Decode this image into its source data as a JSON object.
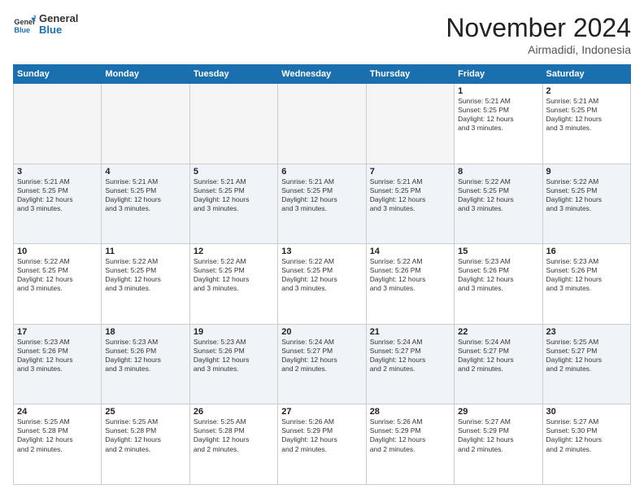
{
  "logo": {
    "line1": "General",
    "line2": "Blue"
  },
  "title": "November 2024",
  "location": "Airmadidi, Indonesia",
  "weekdays": [
    "Sunday",
    "Monday",
    "Tuesday",
    "Wednesday",
    "Thursday",
    "Friday",
    "Saturday"
  ],
  "weeks": [
    [
      {
        "day": "",
        "info": ""
      },
      {
        "day": "",
        "info": ""
      },
      {
        "day": "",
        "info": ""
      },
      {
        "day": "",
        "info": ""
      },
      {
        "day": "",
        "info": ""
      },
      {
        "day": "1",
        "info": "Sunrise: 5:21 AM\nSunset: 5:25 PM\nDaylight: 12 hours\nand 3 minutes."
      },
      {
        "day": "2",
        "info": "Sunrise: 5:21 AM\nSunset: 5:25 PM\nDaylight: 12 hours\nand 3 minutes."
      }
    ],
    [
      {
        "day": "3",
        "info": "Sunrise: 5:21 AM\nSunset: 5:25 PM\nDaylight: 12 hours\nand 3 minutes."
      },
      {
        "day": "4",
        "info": "Sunrise: 5:21 AM\nSunset: 5:25 PM\nDaylight: 12 hours\nand 3 minutes."
      },
      {
        "day": "5",
        "info": "Sunrise: 5:21 AM\nSunset: 5:25 PM\nDaylight: 12 hours\nand 3 minutes."
      },
      {
        "day": "6",
        "info": "Sunrise: 5:21 AM\nSunset: 5:25 PM\nDaylight: 12 hours\nand 3 minutes."
      },
      {
        "day": "7",
        "info": "Sunrise: 5:21 AM\nSunset: 5:25 PM\nDaylight: 12 hours\nand 3 minutes."
      },
      {
        "day": "8",
        "info": "Sunrise: 5:22 AM\nSunset: 5:25 PM\nDaylight: 12 hours\nand 3 minutes."
      },
      {
        "day": "9",
        "info": "Sunrise: 5:22 AM\nSunset: 5:25 PM\nDaylight: 12 hours\nand 3 minutes."
      }
    ],
    [
      {
        "day": "10",
        "info": "Sunrise: 5:22 AM\nSunset: 5:25 PM\nDaylight: 12 hours\nand 3 minutes."
      },
      {
        "day": "11",
        "info": "Sunrise: 5:22 AM\nSunset: 5:25 PM\nDaylight: 12 hours\nand 3 minutes."
      },
      {
        "day": "12",
        "info": "Sunrise: 5:22 AM\nSunset: 5:25 PM\nDaylight: 12 hours\nand 3 minutes."
      },
      {
        "day": "13",
        "info": "Sunrise: 5:22 AM\nSunset: 5:25 PM\nDaylight: 12 hours\nand 3 minutes."
      },
      {
        "day": "14",
        "info": "Sunrise: 5:22 AM\nSunset: 5:26 PM\nDaylight: 12 hours\nand 3 minutes."
      },
      {
        "day": "15",
        "info": "Sunrise: 5:23 AM\nSunset: 5:26 PM\nDaylight: 12 hours\nand 3 minutes."
      },
      {
        "day": "16",
        "info": "Sunrise: 5:23 AM\nSunset: 5:26 PM\nDaylight: 12 hours\nand 3 minutes."
      }
    ],
    [
      {
        "day": "17",
        "info": "Sunrise: 5:23 AM\nSunset: 5:26 PM\nDaylight: 12 hours\nand 3 minutes."
      },
      {
        "day": "18",
        "info": "Sunrise: 5:23 AM\nSunset: 5:26 PM\nDaylight: 12 hours\nand 3 minutes."
      },
      {
        "day": "19",
        "info": "Sunrise: 5:23 AM\nSunset: 5:26 PM\nDaylight: 12 hours\nand 3 minutes."
      },
      {
        "day": "20",
        "info": "Sunrise: 5:24 AM\nSunset: 5:27 PM\nDaylight: 12 hours\nand 2 minutes."
      },
      {
        "day": "21",
        "info": "Sunrise: 5:24 AM\nSunset: 5:27 PM\nDaylight: 12 hours\nand 2 minutes."
      },
      {
        "day": "22",
        "info": "Sunrise: 5:24 AM\nSunset: 5:27 PM\nDaylight: 12 hours\nand 2 minutes."
      },
      {
        "day": "23",
        "info": "Sunrise: 5:25 AM\nSunset: 5:27 PM\nDaylight: 12 hours\nand 2 minutes."
      }
    ],
    [
      {
        "day": "24",
        "info": "Sunrise: 5:25 AM\nSunset: 5:28 PM\nDaylight: 12 hours\nand 2 minutes."
      },
      {
        "day": "25",
        "info": "Sunrise: 5:25 AM\nSunset: 5:28 PM\nDaylight: 12 hours\nand 2 minutes."
      },
      {
        "day": "26",
        "info": "Sunrise: 5:25 AM\nSunset: 5:28 PM\nDaylight: 12 hours\nand 2 minutes."
      },
      {
        "day": "27",
        "info": "Sunrise: 5:26 AM\nSunset: 5:29 PM\nDaylight: 12 hours\nand 2 minutes."
      },
      {
        "day": "28",
        "info": "Sunrise: 5:26 AM\nSunset: 5:29 PM\nDaylight: 12 hours\nand 2 minutes."
      },
      {
        "day": "29",
        "info": "Sunrise: 5:27 AM\nSunset: 5:29 PM\nDaylight: 12 hours\nand 2 minutes."
      },
      {
        "day": "30",
        "info": "Sunrise: 5:27 AM\nSunset: 5:30 PM\nDaylight: 12 hours\nand 2 minutes."
      }
    ]
  ]
}
